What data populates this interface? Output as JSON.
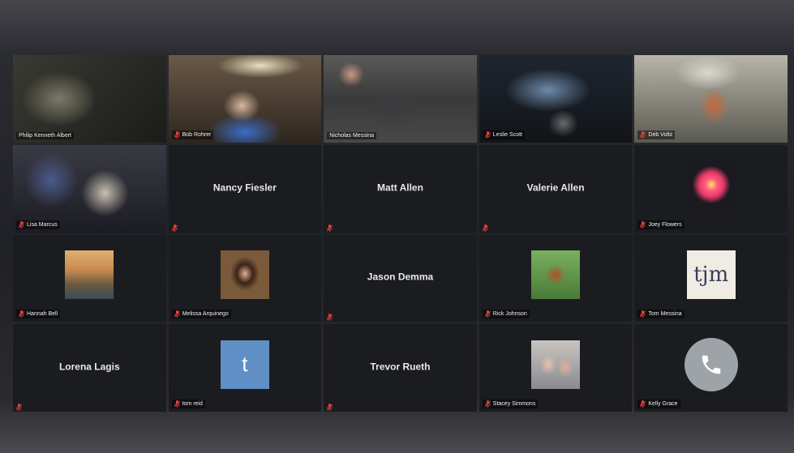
{
  "participants": [
    {
      "name": "Philip Kenneth Albert",
      "kind": "video",
      "active": true,
      "muted": false
    },
    {
      "name": "Bob Rohrer",
      "kind": "video",
      "muted": true
    },
    {
      "name": "Nicholas Messina",
      "kind": "video",
      "muted": false
    },
    {
      "name": "Leslie Scott",
      "kind": "video",
      "muted": true
    },
    {
      "name": "Deb Voltz",
      "kind": "video",
      "muted": true
    },
    {
      "name": "Lisa Marcus",
      "kind": "video",
      "muted": true
    },
    {
      "name": "Nancy Fiesler",
      "kind": "name",
      "muted": true
    },
    {
      "name": "Matt Allen",
      "kind": "name",
      "muted": true
    },
    {
      "name": "Valerie Allen",
      "kind": "name",
      "muted": true
    },
    {
      "name": "Joey Flowers",
      "kind": "avatar",
      "avatar": "flower-avatar",
      "muted": true
    },
    {
      "name": "Hannah Bell",
      "kind": "avatar",
      "avatar": "landscape-avatar",
      "muted": true
    },
    {
      "name": "Melissa Arquinego",
      "kind": "avatar",
      "avatar": "portrait-avatar",
      "muted": true
    },
    {
      "name": "Jason Demma",
      "kind": "name",
      "muted": true
    },
    {
      "name": "Rick Johnson",
      "kind": "avatar",
      "avatar": "chicken-avatar",
      "muted": true
    },
    {
      "name": "Tom Messina",
      "kind": "avatar",
      "avatar": "tjm-logo",
      "avatar_text": "tjm",
      "muted": true
    },
    {
      "name": "Lorena Lagis",
      "kind": "name",
      "muted": true
    },
    {
      "name": "tom reid",
      "kind": "avatar",
      "avatar": "letter-avatar",
      "avatar_text": "t",
      "muted": true
    },
    {
      "name": "Trevor Rueth",
      "kind": "name",
      "muted": true
    },
    {
      "name": "Stacey Simmons",
      "kind": "avatar",
      "avatar": "family-avatar",
      "muted": true
    },
    {
      "name": "Kelly Grace",
      "kind": "phone",
      "muted": true
    }
  ],
  "colors": {
    "active_border": "#b4d23a",
    "muted_icon": "#e0403a",
    "tile_bg": "#1b1c20"
  }
}
